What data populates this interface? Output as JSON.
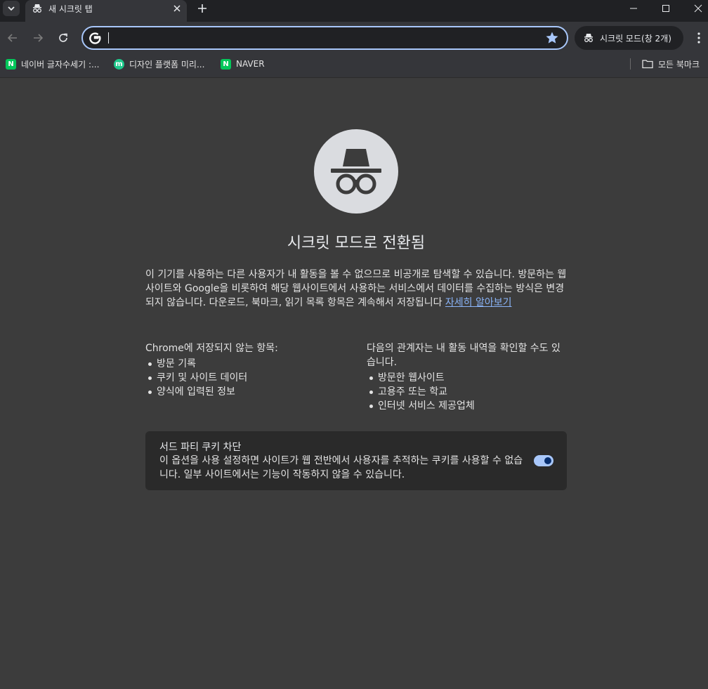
{
  "tabstrip": {
    "active_tab_title": "새 시크릿 탭"
  },
  "toolbar": {
    "omnibox_value": "",
    "incognito_label": "시크릿 모드(창 2개)"
  },
  "bookmarks": {
    "items": [
      {
        "label": "네이버 글자수세기 :...",
        "favicon": "N",
        "color": "#03c75a"
      },
      {
        "label": "디자인 플랫폼 미리...",
        "favicon": "m",
        "color": "#1ec98c"
      },
      {
        "label": "NAVER",
        "favicon": "N",
        "color": "#03c75a"
      }
    ],
    "all_bookmarks_label": "모든 북마크"
  },
  "content": {
    "title": "시크릿 모드로 전환됨",
    "description": "이 기기를 사용하는 다른 사용자가 내 활동을 볼 수 없으므로 비공개로 탐색할 수 있습니다. 방문하는 웹사이트와 Google을 비롯하여 해당 웹사이트에서 사용하는 서비스에서 데이터를 수집하는 방식은 변경되지 않습니다. 다운로드, 북마크, 읽기 목록 항목은 계속해서 저장됩니다 ",
    "learn_more": "자세히 알아보기",
    "not_saved": {
      "heading": "Chrome에 저장되지 않는 항목:",
      "items": [
        "방문 기록",
        "쿠키 및 사이트 데이터",
        "양식에 입력된 정보"
      ]
    },
    "may_be_visible": {
      "heading": "다음의 관계자는 내 활동 내역을 확인할 수도 있습니다.",
      "items": [
        "방문한 웹사이트",
        "고용주 또는 학교",
        "인터넷 서비스 제공업체"
      ]
    },
    "cookie_card": {
      "title": "서드 파티 쿠키 차단",
      "description": "이 옵션을 사용 설정하면 사이트가 웹 전반에서 사용자를 추적하는 쿠키를 사용할 수 없습니다. 일부 사이트에서는 기능이 작동하지 않을 수 있습니다.",
      "enabled": true
    }
  },
  "colors": {
    "page_bg": "#3c3c3c",
    "accent": "#a8c7fa",
    "link": "#8ab4f8"
  }
}
